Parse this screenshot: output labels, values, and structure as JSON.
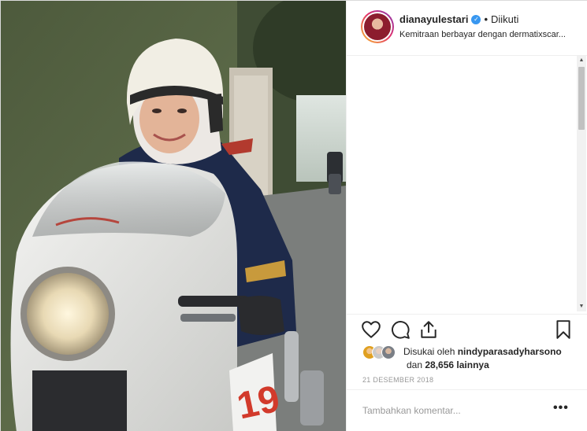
{
  "post": {
    "username": "dianayulestari",
    "verified_mark": "✓",
    "separator": "•",
    "follow_status": "Diikuti",
    "sponsor_prefix": "Kemitraan berbayar dengan ",
    "sponsor_brand": "dermatixscar...",
    "photo_subject": "woman in white helmet riding white cafe-racer motorcycle",
    "likes_prefix": "Disukai oleh ",
    "likes_user": "nindyparasadyharsono",
    "likes_suffix_prefix": "dan ",
    "likes_count": "28,656",
    "likes_suffix": " lainnya",
    "date": "21 DESEMBER 2018",
    "comment_placeholder": "Tambahkan komentar...",
    "more_options": "•••"
  },
  "icons": {
    "like": "heart-outline-icon",
    "comment": "speech-bubble-icon",
    "share": "share-upload-icon",
    "save": "bookmark-icon",
    "more": "ellipsis-icon"
  },
  "colors": {
    "verified_blue": "#3897f0",
    "border": "#dbdbdb",
    "muted_text": "#999999"
  }
}
